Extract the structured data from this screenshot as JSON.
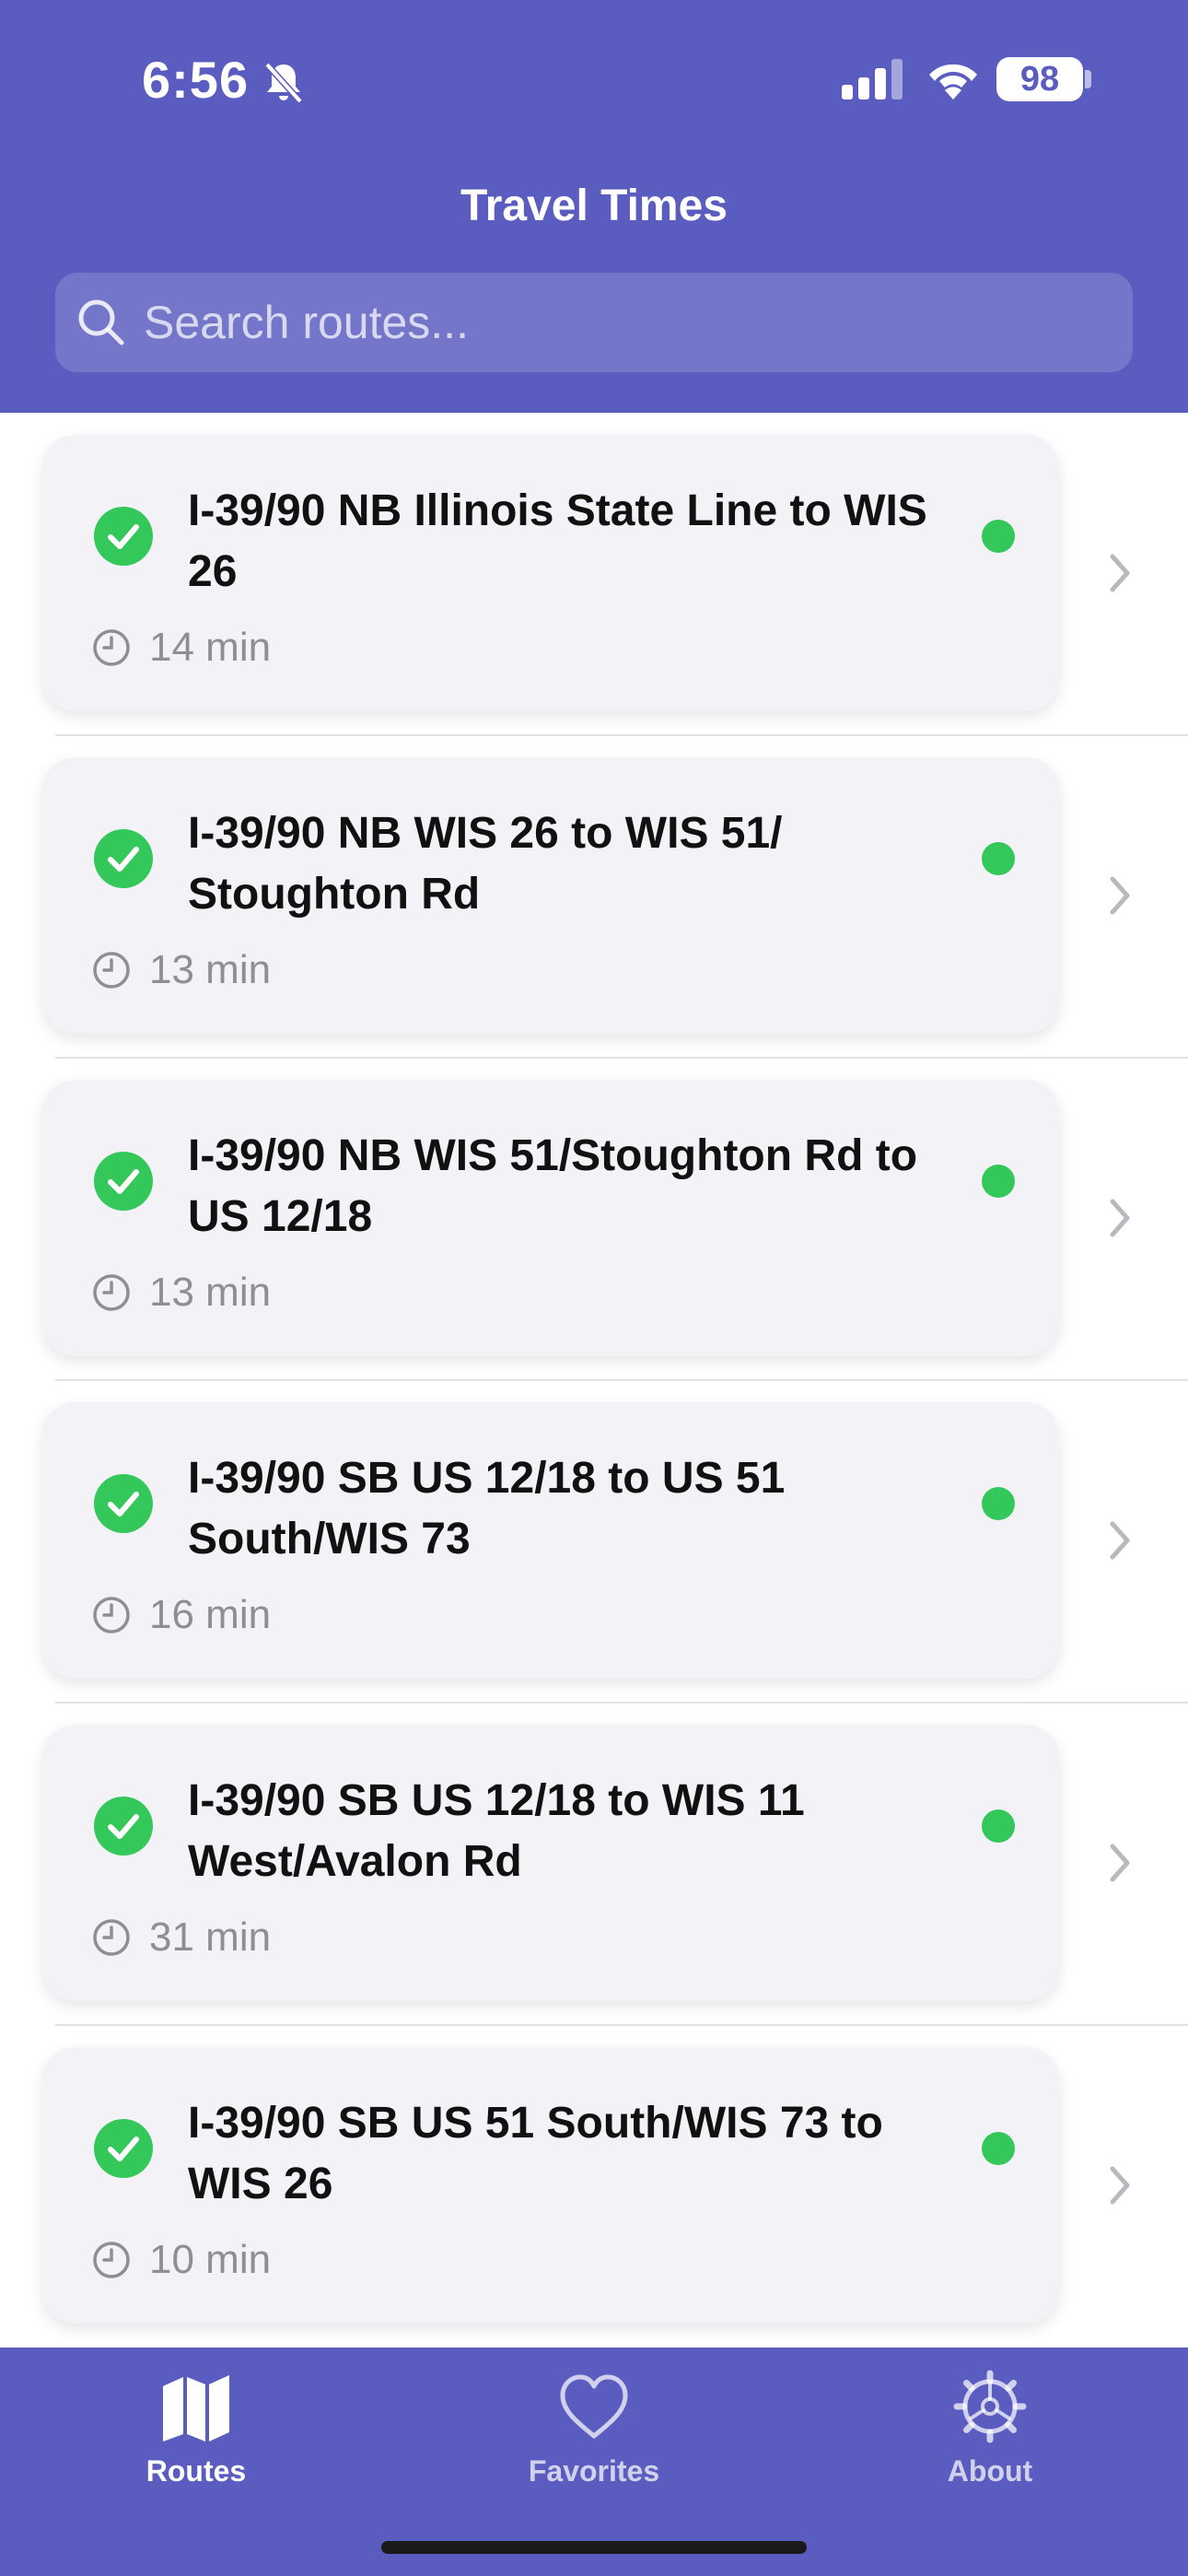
{
  "status_bar": {
    "time": "6:56",
    "battery": "98",
    "icons": [
      "bell-slash-icon",
      "cellular-signal-icon",
      "wifi-icon",
      "battery-icon"
    ]
  },
  "header": {
    "title": "Travel Times",
    "search_placeholder": "Search routes...",
    "background_color": "#5A5CBF"
  },
  "routes": [
    {
      "name": "I-39/90 NB Illinois State Line to WIS 26",
      "duration": "14 min",
      "status_color": "#34C759"
    },
    {
      "name": "I-39/90 NB WIS 26 to WIS 51/ Stoughton Rd",
      "duration": "13 min",
      "status_color": "#34C759"
    },
    {
      "name": "I-39/90 NB WIS 51/Stoughton Rd to US 12/18",
      "duration": "13 min",
      "status_color": "#34C759"
    },
    {
      "name": "I-39/90 SB US 12/18 to US 51 South/WIS 73",
      "duration": "16 min",
      "status_color": "#34C759"
    },
    {
      "name": "I-39/90 SB US 12/18 to WIS 11 West/Avalon Rd",
      "duration": "31 min",
      "status_color": "#34C759"
    },
    {
      "name": "I-39/90 SB US 51 South/WIS 73 to WIS 26",
      "duration": "10 min",
      "status_color": "#34C759"
    }
  ],
  "tabs": [
    {
      "label": "Routes",
      "icon": "map-icon",
      "active": true
    },
    {
      "label": "Favorites",
      "icon": "heart-icon",
      "active": false
    },
    {
      "label": "About",
      "icon": "gear-icon",
      "active": false
    }
  ],
  "colors": {
    "accent": "#5A5CBF",
    "status_ok": "#34C759",
    "card_bg": "#F2F2F7",
    "secondary_text": "#8E8E93"
  }
}
